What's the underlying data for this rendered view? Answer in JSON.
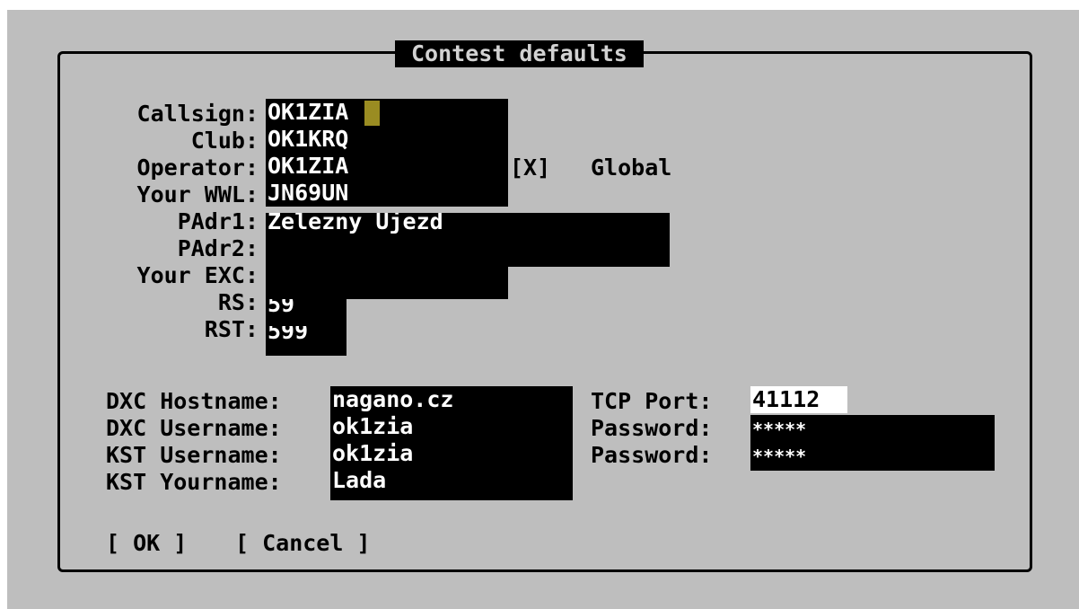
{
  "dialog": {
    "title": "Contest defaults"
  },
  "fields": {
    "callsign": {
      "label": "Callsign:",
      "value": "OK1ZIA"
    },
    "club": {
      "label": "Club:",
      "value": "OK1KRQ"
    },
    "operator": {
      "label": "Operator:",
      "value": "OK1ZIA"
    },
    "wwl": {
      "label": "Your WWL:",
      "value": "JN69UN"
    },
    "padr1": {
      "label": "PAdr1:",
      "value": "Zelezny Ujezd"
    },
    "padr2": {
      "label": "PAdr2:",
      "value": ""
    },
    "exc": {
      "label": "Your EXC:",
      "value": ""
    },
    "rs": {
      "label": "RS:",
      "value": "59"
    },
    "rst": {
      "label": "RST:",
      "value": "599"
    }
  },
  "global": {
    "checkbox": "[X]",
    "label": "Global",
    "checked": true
  },
  "network": {
    "dxc_hostname": {
      "label": "DXC Hostname:",
      "value": "nagano.cz"
    },
    "dxc_username": {
      "label": "DXC Username:",
      "value": "ok1zia"
    },
    "kst_username": {
      "label": "KST Username:",
      "value": "ok1zia"
    },
    "kst_yourname": {
      "label": "KST Yourname:",
      "value": "Lada"
    },
    "tcp_port": {
      "label": "TCP Port:",
      "value": "41112"
    },
    "dxc_password": {
      "label": "Password:",
      "value": "*****"
    },
    "kst_password": {
      "label": "Password:",
      "value": "*****"
    }
  },
  "buttons": {
    "ok": "[ OK ]",
    "cancel": "[ Cancel ]"
  },
  "colors": {
    "desktop": "#bebebe",
    "field_bg": "#000000",
    "field_text": "#ffffff",
    "cursor": "#9a8c22"
  }
}
